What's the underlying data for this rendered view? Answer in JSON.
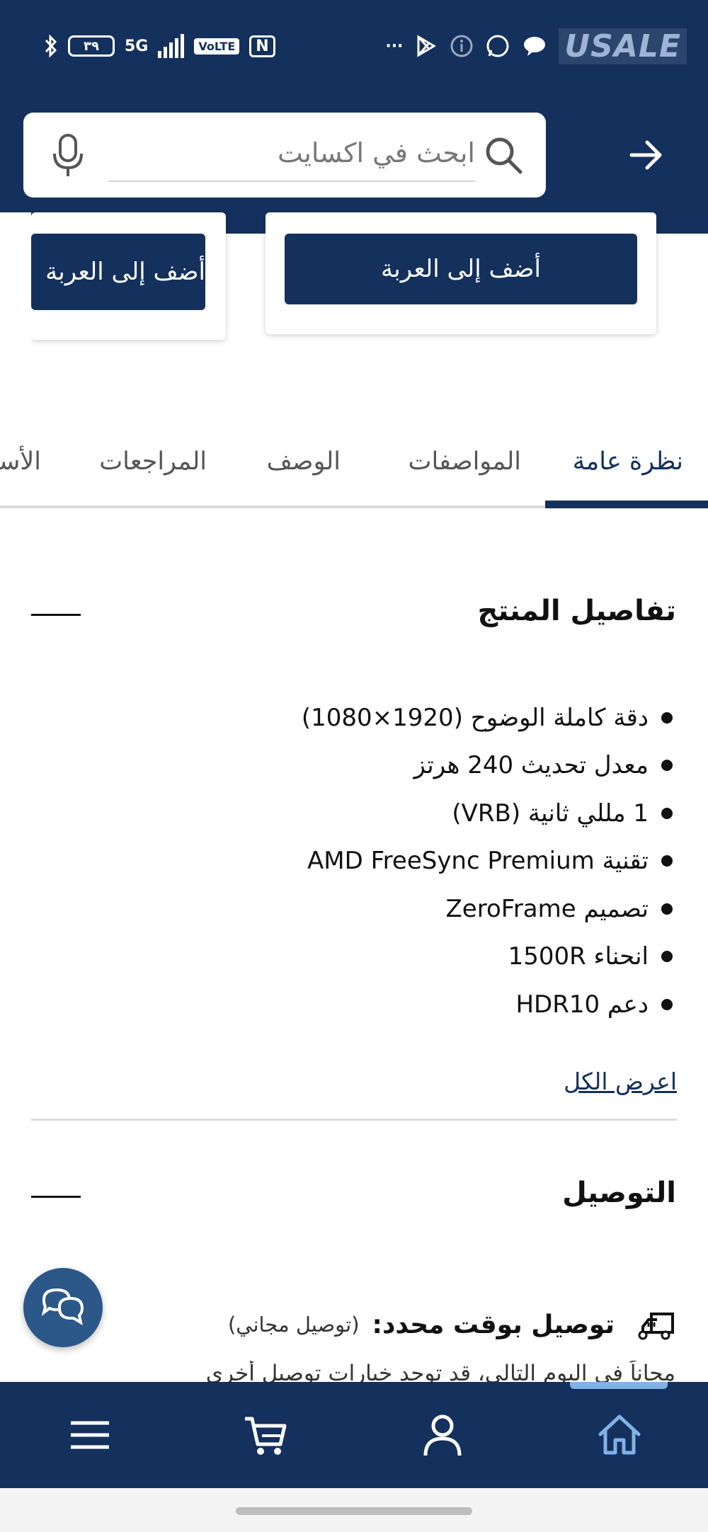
{
  "status_bar": {
    "battery": "٣٩",
    "network": "5G",
    "volte": "VoLTE",
    "nfc": "N",
    "more": "···",
    "watermark": "USALE"
  },
  "search": {
    "placeholder": "ابحث في اكسايت"
  },
  "cards": [
    {
      "add_to_cart": "أضف إلى العربة"
    },
    {
      "add_to_cart": "أضف إلى العربة"
    }
  ],
  "tabs": [
    {
      "label": "نظرة عامة",
      "active": true
    },
    {
      "label": "المواصفات",
      "active": false
    },
    {
      "label": "الوصف",
      "active": false
    },
    {
      "label": "المراجعات",
      "active": false
    },
    {
      "label": "الأسئلة",
      "active": false
    }
  ],
  "product_details": {
    "title": "تفاصيل المنتج",
    "features": [
      "دقة كاملة الوضوح (1920×1080)",
      "معدل تحديث 240 هرتز",
      "1 مللي ثانية (VRB)",
      "تقنية AMD FreeSync Premium",
      "تصميم ZeroFrame",
      "انحناء 1500R",
      "دعم HDR10"
    ],
    "show_all": "اعرض الكل"
  },
  "delivery": {
    "title": "التوصيل",
    "row_title": "توصيل بوقت محدد:",
    "row_note": "(توصيل مجاني)",
    "text": "مجاناً في اليوم التالي، قد توجد خيارات توصيل أخرى"
  },
  "colors": {
    "brand": "#14305c",
    "accent": "#7fb2e6",
    "fab": "#2b5789"
  },
  "bottom_nav": [
    {
      "icon": "home-icon",
      "active": true
    },
    {
      "icon": "user-icon",
      "active": false
    },
    {
      "icon": "cart-icon",
      "active": false
    },
    {
      "icon": "menu-icon",
      "active": false
    }
  ]
}
